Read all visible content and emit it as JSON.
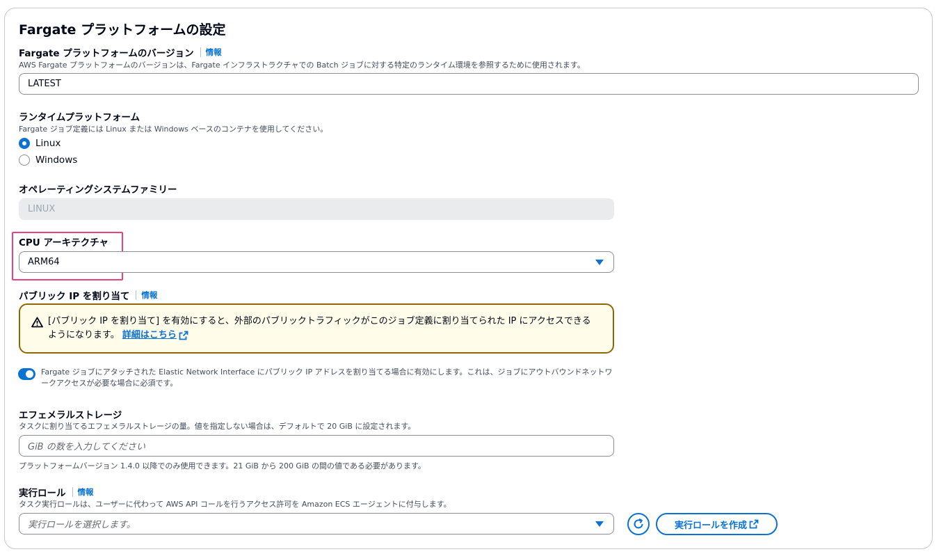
{
  "section": {
    "title": "Fargate プラットフォームの設定"
  },
  "platform_version": {
    "label": "Fargate プラットフォームのバージョン",
    "info": "情報",
    "description": "AWS Fargate プラットフォームのバージョンは、Fargate インフラストラクチャでの Batch ジョブに対する特定のランタイム環境を参照するために使用されます。",
    "value": "LATEST"
  },
  "runtime_platform": {
    "label": "ランタイムプラットフォーム",
    "description": "Fargate ジョブ定義には Linux または Windows ベースのコンテナを使用してください。",
    "options": [
      {
        "label": "Linux",
        "selected": true
      },
      {
        "label": "Windows",
        "selected": false
      }
    ]
  },
  "os_family": {
    "label": "オペレーティングシステムファミリー",
    "value": "LINUX"
  },
  "cpu_architecture": {
    "label": "CPU アーキテクチャ",
    "value": "ARM64"
  },
  "public_ip": {
    "label": "パブリック IP を割り当て",
    "info": "情報",
    "alert_text": "[パブリック IP を割り当て] を有効にすると、外部のパブリックトラフィックがこのジョブ定義に割り当てられた IP にアクセスできるようになります。",
    "alert_link": "詳細はこちら",
    "toggle_on": true,
    "toggle_description": "Fargate ジョブにアタッチされた Elastic Network Interface にパブリック IP アドレスを割り当てる場合に有効にします。これは、ジョブにアウトバウンドネットワークアクセスが必要な場合に必須です。"
  },
  "ephemeral_storage": {
    "label": "エフェメラルストレージ",
    "description": "タスクに割り当てるエフェメラルストレージの量。値を指定しない場合は、デフォルトで 20 GiB に設定されます。",
    "placeholder": "GiB の数を入力してください",
    "constraint": "プラットフォームバージョン 1.4.0 以降でのみ使用できます。21 GiB から 200 GiB の間の値である必要があります。"
  },
  "execution_role": {
    "label": "実行ロール",
    "info": "情報",
    "description": "タスク実行ロールは、ユーザーに代わって AWS API コールを行うアクセス許可を Amazon ECS エージェントに付与します。",
    "placeholder": "実行ロールを選択します。",
    "create_button": "実行ロールを作成"
  },
  "colors": {
    "accent": "#0972d3",
    "warning_border": "#8d6605",
    "highlight": "#e8427b"
  }
}
